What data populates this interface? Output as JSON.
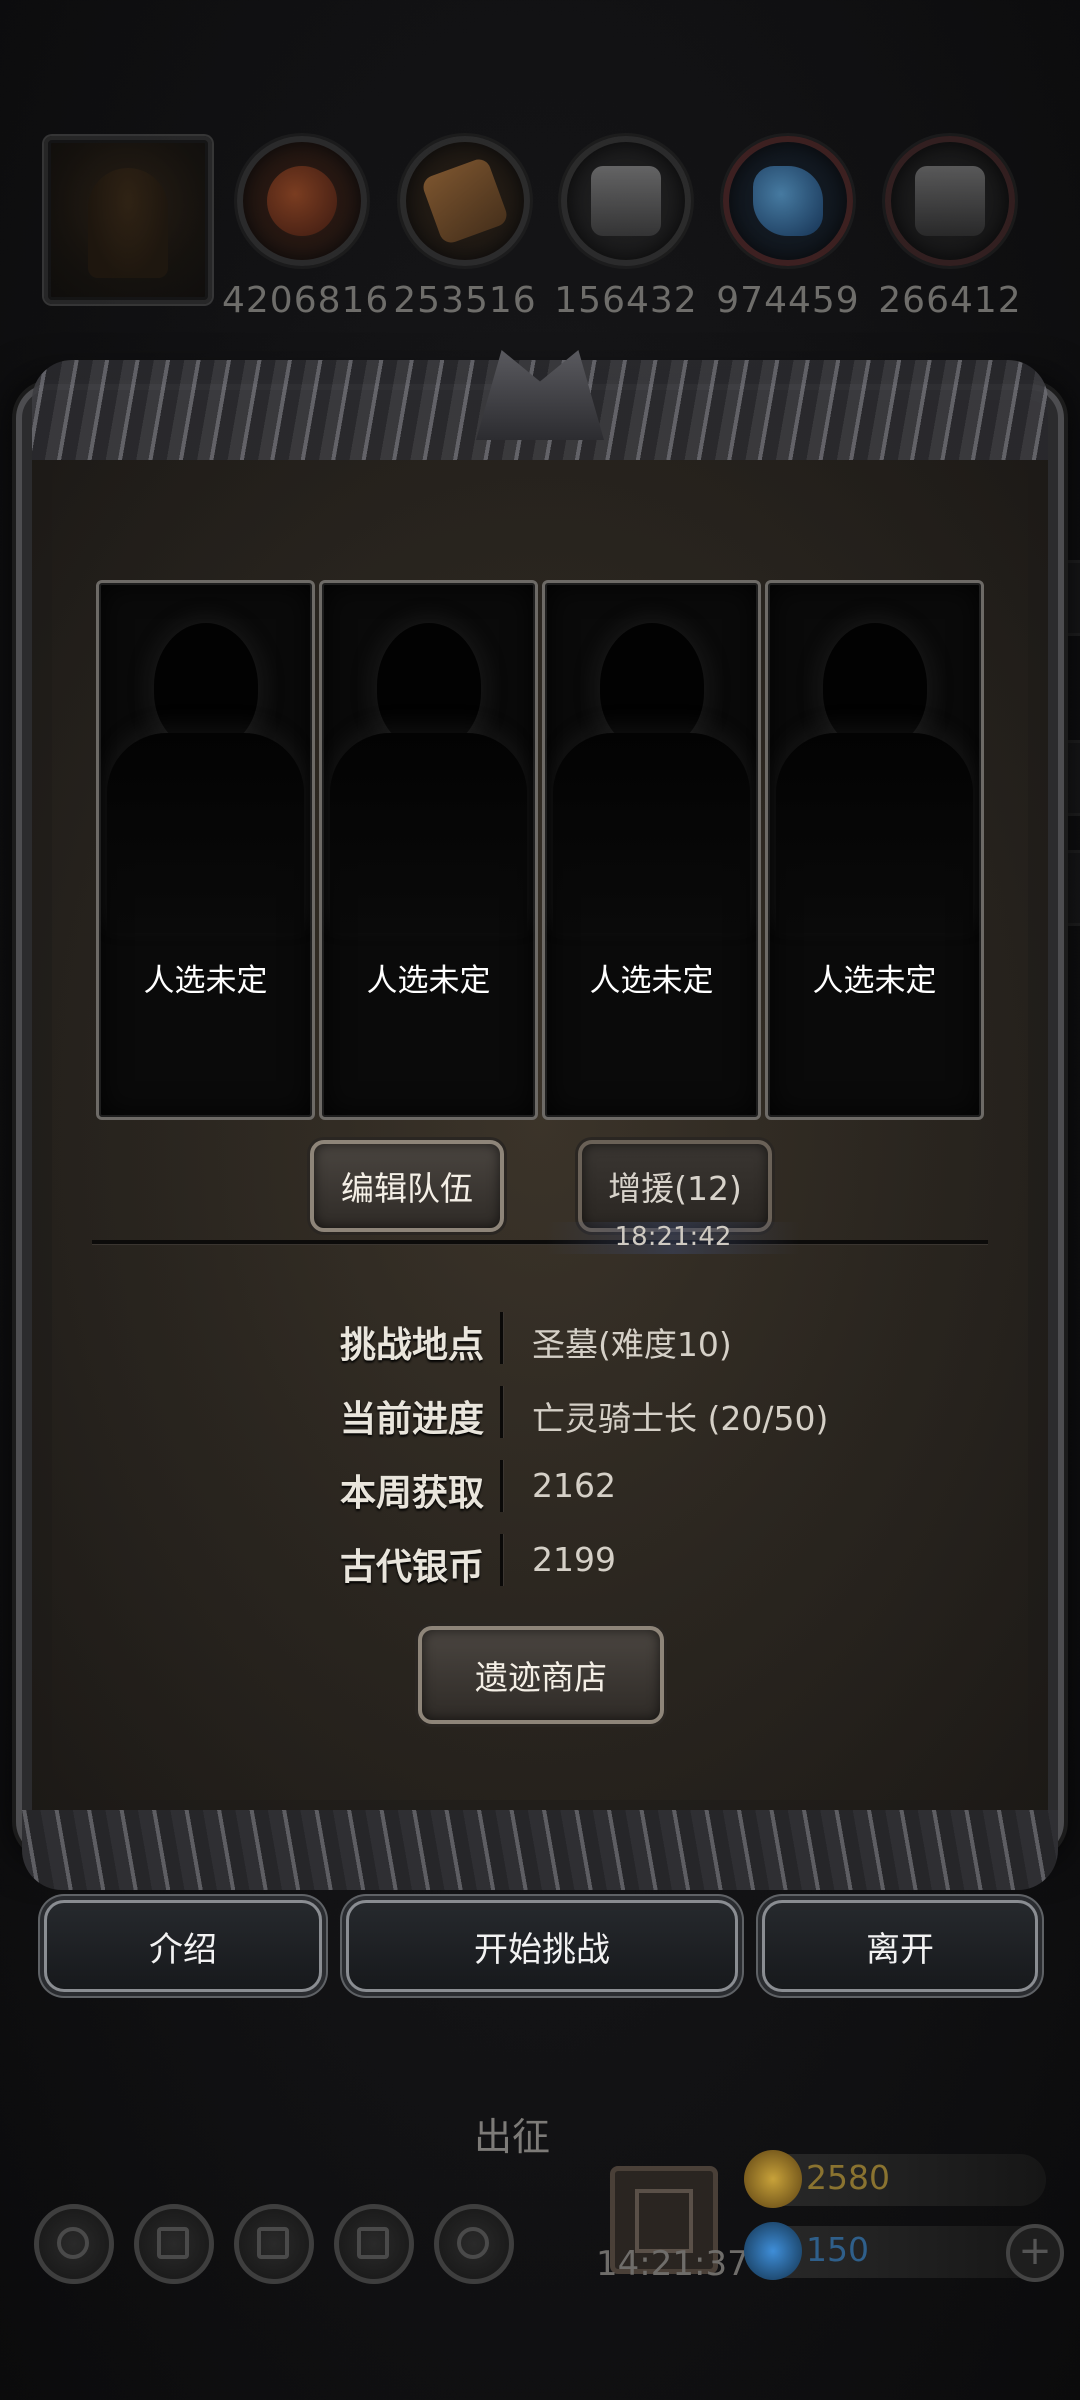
{
  "resources": [
    {
      "icon": "meat-icon",
      "value": "4206816",
      "color": "#8a3a1e"
    },
    {
      "icon": "wood-icon",
      "value": "253516",
      "color": "#a0662e"
    },
    {
      "icon": "stone-icon",
      "value": "156432",
      "color": "#8a8a8a"
    },
    {
      "icon": "crystal-icon",
      "value": "974459",
      "color": "#2f7fc0"
    },
    {
      "icon": "iron-icon",
      "value": "266412",
      "color": "#6f6f6f"
    }
  ],
  "slots": [
    {
      "label": "人选未定"
    },
    {
      "label": "人选未定"
    },
    {
      "label": "人选未定"
    },
    {
      "label": "人选未定"
    }
  ],
  "team": {
    "edit_label": "编辑队伍",
    "reinforce_label": "增援(12)",
    "reinforce_timer": "18:21:42"
  },
  "info": [
    {
      "key": "挑战地点",
      "value": "圣墓(难度10)"
    },
    {
      "key": "当前进度",
      "value": "亡灵骑士长 (20/50)"
    },
    {
      "key": "本周获取",
      "value": "2162"
    },
    {
      "key": "古代银币",
      "value": "2199"
    }
  ],
  "shop_label": "遗迹商店",
  "actions": {
    "intro": "介绍",
    "start": "开始挑战",
    "leave": "离开"
  },
  "background": {
    "expedition_label": "出征",
    "gift_timer": "14:21:37",
    "gold": "2580",
    "gems": "150",
    "gold_color": "#c8a23a",
    "gem_color": "#3f8ed8"
  }
}
